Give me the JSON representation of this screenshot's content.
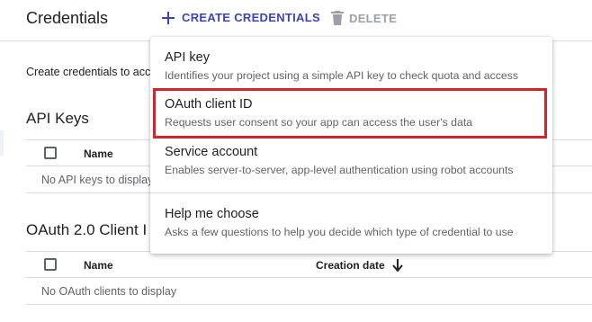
{
  "header": {
    "title": "Credentials",
    "create_label": "CREATE CREDENTIALS",
    "delete_label": "DELETE"
  },
  "intro_text": "Create credentials to acc",
  "api_keys": {
    "title": "API Keys",
    "col_name": "Name",
    "empty_text": "No API keys to display"
  },
  "oauth": {
    "title": "OAuth 2.0 Client I",
    "col_name": "Name",
    "col_date": "Creation date",
    "empty_text": "No OAuth clients to display"
  },
  "menu": {
    "items": [
      {
        "label": "API key",
        "description": "Identifies your project using a simple API key to check quota and access"
      },
      {
        "label": "OAuth client ID",
        "description": "Requests user consent so your app can access the user's data"
      },
      {
        "label": "Service account",
        "description": "Enables server-to-server, app-level authentication using robot accounts"
      },
      {
        "label": "Help me choose",
        "description": "Asks a few questions to help you decide which type of credential to use"
      }
    ],
    "highlighted_item": "OAuth client ID"
  },
  "colors": {
    "accent": "#3c44b4",
    "disabled": "#9aa0a6",
    "highlight": "#d1252b"
  },
  "icons": [
    "plus-icon",
    "trash-icon",
    "arrow-down-icon"
  ]
}
